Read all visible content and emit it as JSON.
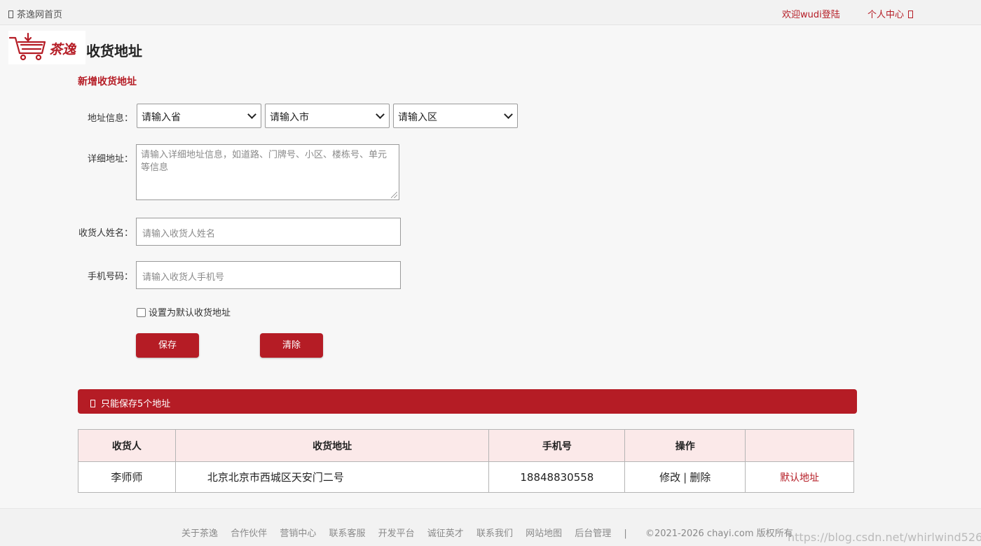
{
  "topbar": {
    "home_label": "茶逸网首页",
    "welcome": "欢迎wudi登陆",
    "personal_center": "个人中心"
  },
  "header": {
    "logo_text": "茶逸",
    "page_title": "收货地址"
  },
  "form": {
    "section_title": "新增收货地址",
    "region_label": "地址信息：",
    "province_value": "请输入省",
    "city_value": "请输入市",
    "district_value": "请输入区",
    "detail_label": "详细地址：",
    "detail_placeholder": "请输入详细地址信息，如道路、门牌号、小区、楼栋号、单元等信息",
    "name_label": "收货人姓名：",
    "name_placeholder": "请输入收货人姓名",
    "phone_label": "手机号码：",
    "phone_placeholder": "请输入收货人手机号",
    "default_checkbox_label": "设置为默认收货地址",
    "save_label": "保存",
    "clear_label": "清除"
  },
  "notice": {
    "text": "只能保存5个地址"
  },
  "table": {
    "headers": [
      "收货人",
      "收货地址",
      "手机号",
      "操作",
      ""
    ],
    "rows": [
      {
        "name": "李师师",
        "address": "北京北京市西城区天安门二号",
        "phone": "18848830558",
        "edit": "修改",
        "separator": "|",
        "delete": "删除",
        "default": "默认地址"
      }
    ]
  },
  "footer": {
    "links": [
      "关于茶逸",
      "合作伙伴",
      "营销中心",
      "联系客服",
      "开发平台",
      "诚征英才",
      "联系我们",
      "网站地图",
      "后台管理"
    ],
    "divider": "|",
    "copyright": "©2021-2026 chayi.com 版权所有"
  },
  "watermark": "https://blog.csdn.net/whirlwind526",
  "colors": {
    "brand": "#b51c25",
    "header_bg": "#fbe9e9",
    "page_bg": "#f7f7f7"
  },
  "icons": [
    "home-icon",
    "user-icon",
    "cart-logo-icon",
    "info-icon",
    "chevron-down-icon"
  ]
}
